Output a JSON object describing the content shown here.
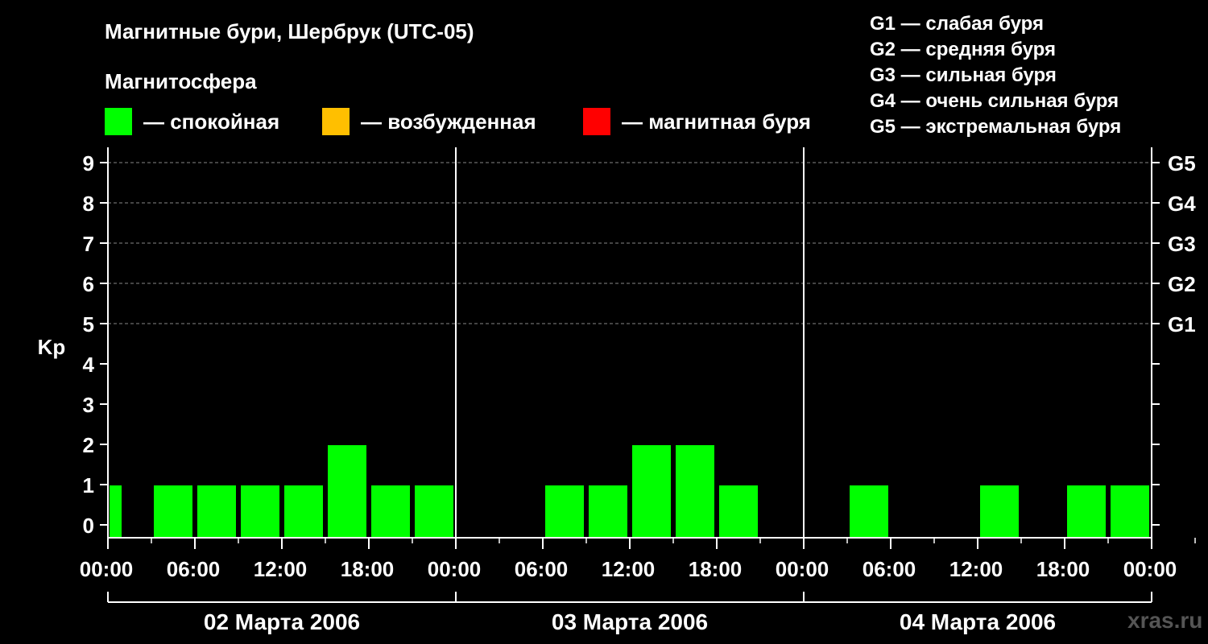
{
  "title": "Магнитные бури, Шербрук (UTC-05)",
  "legend": {
    "heading": "Магнитосфера",
    "items": [
      {
        "label": "— спокойная",
        "color": "#00ff00"
      },
      {
        "label": "— возбужденная",
        "color": "#ffbf00"
      },
      {
        "label": "— магнитная буря",
        "color": "#ff0000"
      }
    ]
  },
  "storm_scale": [
    "G1 — слабая буря",
    "G2 — средняя буря",
    "G3 — сильная буря",
    "G4 — очень сильная буря",
    "G5 — экстремальная буря"
  ],
  "watermark": "xras.ru",
  "chart_data": {
    "type": "bar",
    "ylabel": "Kp",
    "ylim": [
      0,
      9
    ],
    "yticks": [
      0,
      1,
      2,
      3,
      4,
      5,
      6,
      7,
      8,
      9
    ],
    "g_levels": [
      {
        "label": "G1",
        "kp": 5
      },
      {
        "label": "G2",
        "kp": 6
      },
      {
        "label": "G3",
        "kp": 7
      },
      {
        "label": "G4",
        "kp": 8
      },
      {
        "label": "G5",
        "kp": 9
      }
    ],
    "x_tick_labels": [
      "00:00",
      "06:00",
      "12:00",
      "18:00",
      "00:00",
      "06:00",
      "12:00",
      "18:00",
      "00:00",
      "06:00",
      "12:00",
      "18:00",
      "00:00"
    ],
    "days": [
      {
        "label": "02 Марта 2006",
        "kp": [
          1,
          1,
          1,
          1,
          1,
          2,
          1,
          1
        ]
      },
      {
        "label": "03 Марта 2006",
        "kp": [
          null,
          null,
          1,
          1,
          2,
          2,
          1,
          null
        ]
      },
      {
        "label": "04 Марта 2006",
        "kp": [
          null,
          1,
          null,
          null,
          1,
          null,
          1,
          1
        ]
      }
    ],
    "first_bar_partial": true,
    "grid": "dashed at Kp 5–9",
    "colors": {
      "quiet": "#00ff00",
      "active": "#ffbf00",
      "storm": "#ff0000"
    }
  }
}
